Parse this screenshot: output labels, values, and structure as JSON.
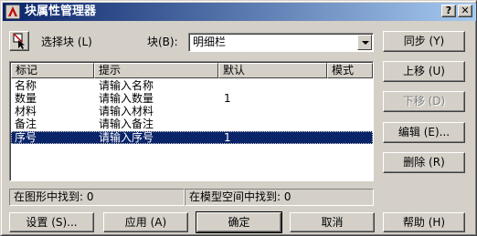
{
  "window": {
    "title": "块属性管理器",
    "help_glyph": "?",
    "close_glyph": "✕"
  },
  "toolbar": {
    "select_block_label": "选择块 (L)",
    "block_label": "块(B):",
    "block_value": "明细栏"
  },
  "table": {
    "columns": [
      "标记",
      "提示",
      "默认",
      "模式"
    ],
    "rows": [
      {
        "tag": "名称",
        "prompt": "请输入名称",
        "default": "",
        "selected": false
      },
      {
        "tag": "数量",
        "prompt": "请输入数量",
        "default": "1",
        "selected": false
      },
      {
        "tag": "材料",
        "prompt": "请输入材料",
        "default": "",
        "selected": false
      },
      {
        "tag": "备注",
        "prompt": "请输入备注",
        "default": "",
        "selected": false
      },
      {
        "tag": "序号",
        "prompt": "请输入序号",
        "default": "1",
        "selected": true
      }
    ]
  },
  "side_buttons": {
    "sync": "同步 (Y)",
    "move_up": "上移 (U)",
    "move_down": "下移 (D)",
    "edit": "编辑 (E)...",
    "delete": "删除 (R)"
  },
  "status": {
    "found_in_drawing": "在图形中找到: 0",
    "found_in_modelspace": "在模型空间中找到: 0"
  },
  "bottom_buttons": {
    "settings": "设置 (S)...",
    "apply": "应用 (A)",
    "ok": "确定",
    "cancel": "取消",
    "help": "帮助 (H)"
  },
  "colors": {
    "title_gradient_start": "#0a246a",
    "title_gradient_end": "#a6caf0",
    "selection": "#0a246a",
    "face": "#d4d0c8"
  }
}
